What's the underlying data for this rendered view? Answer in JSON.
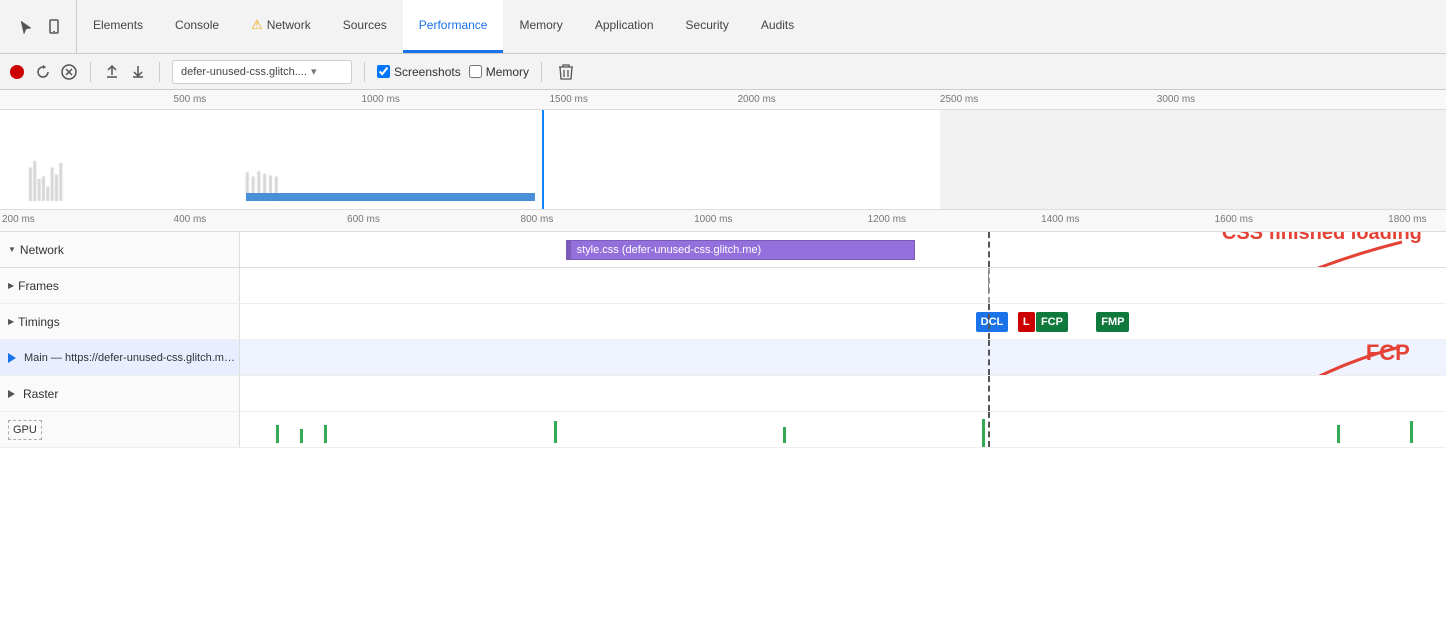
{
  "tabs": {
    "icons": [
      "cursor",
      "phone"
    ],
    "items": [
      {
        "label": "Elements",
        "active": false,
        "warning": false
      },
      {
        "label": "Console",
        "active": false,
        "warning": false
      },
      {
        "label": "Network",
        "active": false,
        "warning": true
      },
      {
        "label": "Sources",
        "active": false,
        "warning": false
      },
      {
        "label": "Performance",
        "active": true,
        "warning": false
      },
      {
        "label": "Memory",
        "active": false,
        "warning": false
      },
      {
        "label": "Application",
        "active": false,
        "warning": false
      },
      {
        "label": "Security",
        "active": false,
        "warning": false
      },
      {
        "label": "Audits",
        "active": false,
        "warning": false
      }
    ]
  },
  "toolbar": {
    "record_label": "Record",
    "reload_label": "Reload",
    "clear_label": "Clear",
    "upload_label": "Upload",
    "download_label": "Download",
    "dropdown_value": "defer-unused-css.glitch....",
    "screenshots_label": "Screenshots",
    "memory_label": "Memory",
    "screenshots_checked": true,
    "memory_checked": false
  },
  "overview": {
    "ticks": [
      "500 ms",
      "1000 ms",
      "1500 ms",
      "2000 ms",
      "2500 ms",
      "3000 ms"
    ]
  },
  "timeline": {
    "ruler_ticks": [
      "200 ms",
      "400 ms",
      "600 ms",
      "800 ms",
      "1000 ms",
      "1200 ms",
      "1400 ms",
      "1600 ms",
      "1800 ms"
    ],
    "network_label": "Network",
    "resource_bar_text": "style.css (defer-unused-css.glitch.me)",
    "tracks": [
      {
        "label": "Frames",
        "collapsed": true
      },
      {
        "label": "Timings",
        "collapsed": true
      },
      {
        "label": "Main",
        "url": "https://defer-unused-css.glitch.me/index-unoptimized.html",
        "collapsed": true
      },
      {
        "label": "Raster",
        "collapsed": true
      },
      {
        "label": "GPU",
        "collapsed": true
      }
    ],
    "timing_badges": [
      {
        "label": "DCL",
        "color": "#1a73e8"
      },
      {
        "label": "L",
        "color": "#cc0000"
      },
      {
        "label": "FCP",
        "color": "#0f7a3c"
      },
      {
        "label": "FMP",
        "color": "#0f7a3c"
      }
    ]
  },
  "annotations": {
    "css_label": "CSS finished loading",
    "fcp_label": "FCP"
  }
}
